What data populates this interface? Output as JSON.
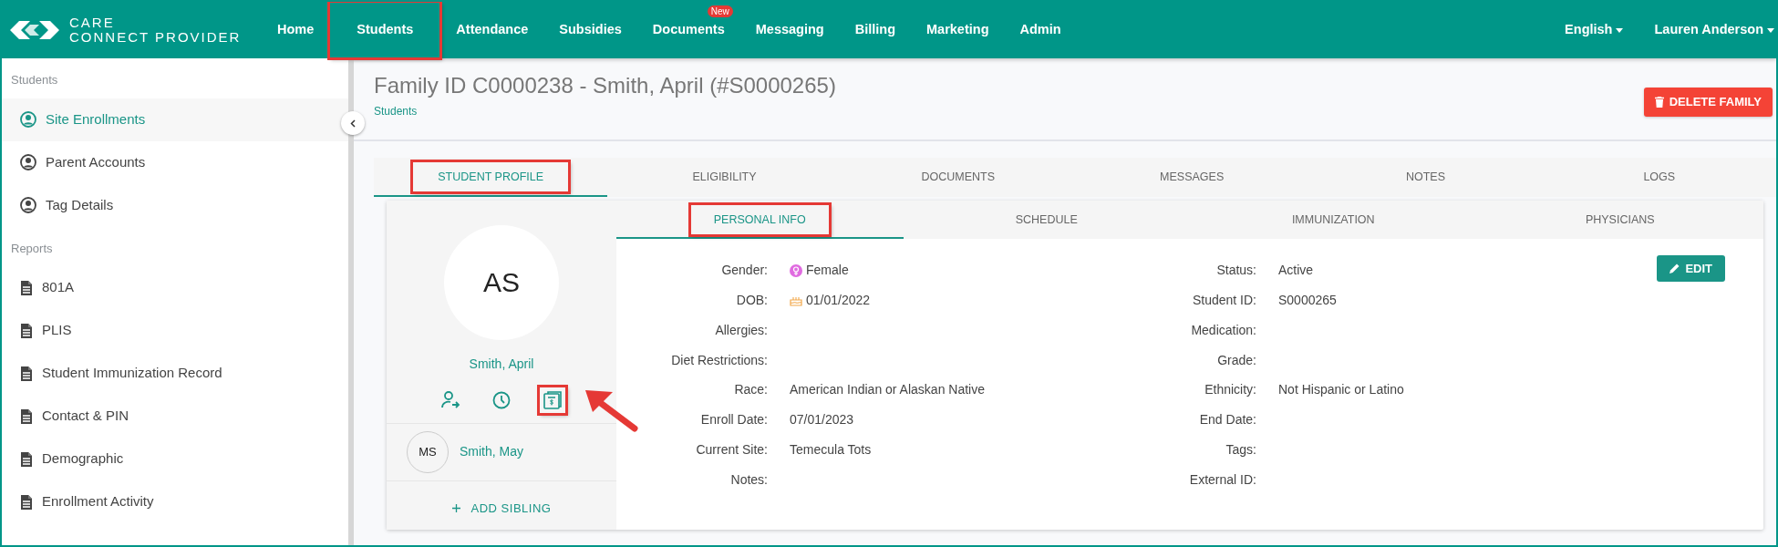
{
  "brand": {
    "line1": "CARE",
    "line2": "CONNECT PROVIDER"
  },
  "nav": {
    "items": [
      {
        "label": "Home",
        "highlighted": false
      },
      {
        "label": "Students",
        "highlighted": true
      },
      {
        "label": "Attendance",
        "highlighted": false
      },
      {
        "label": "Subsidies",
        "highlighted": false
      },
      {
        "label": "Documents",
        "highlighted": false,
        "badge": "New"
      },
      {
        "label": "Messaging",
        "highlighted": false
      },
      {
        "label": "Billing",
        "highlighted": false
      },
      {
        "label": "Marketing",
        "highlighted": false
      },
      {
        "label": "Admin",
        "highlighted": false
      }
    ],
    "language": "English",
    "user": "Lauren Anderson"
  },
  "sidebar": {
    "sections": [
      {
        "title": "Students",
        "items": [
          {
            "label": "Site Enrollments",
            "kind": "person",
            "selected": true
          },
          {
            "label": "Parent Accounts",
            "kind": "person",
            "selected": false
          },
          {
            "label": "Tag Details",
            "kind": "person",
            "selected": false
          }
        ]
      },
      {
        "title": "Reports",
        "items": [
          {
            "label": "801A",
            "kind": "document",
            "selected": false
          },
          {
            "label": "PLIS",
            "kind": "document",
            "selected": false
          },
          {
            "label": "Student Immunization Record",
            "kind": "document",
            "selected": false
          },
          {
            "label": "Contact & PIN",
            "kind": "document",
            "selected": false
          },
          {
            "label": "Demographic",
            "kind": "document",
            "selected": false
          },
          {
            "label": "Enrollment Activity",
            "kind": "document",
            "selected": false
          }
        ]
      }
    ]
  },
  "header": {
    "title": "Family ID C0000238 - Smith, April (#S0000265)",
    "breadcrumb": "Students",
    "delete_button": "DELETE FAMILY"
  },
  "tabs": [
    {
      "label": "STUDENT PROFILE",
      "selected": true,
      "highlighted": true
    },
    {
      "label": "ELIGIBILITY",
      "selected": false,
      "highlighted": false
    },
    {
      "label": "DOCUMENTS",
      "selected": false,
      "highlighted": false
    },
    {
      "label": "MESSAGES",
      "selected": false,
      "highlighted": false
    },
    {
      "label": "NOTES",
      "selected": false,
      "highlighted": false
    },
    {
      "label": "LOGS",
      "selected": false,
      "highlighted": false
    }
  ],
  "profile": {
    "initials": "AS",
    "name": "Smith, April",
    "actions": [
      {
        "kind": "transfer",
        "highlighted": false,
        "pointed": false
      },
      {
        "kind": "history",
        "highlighted": false,
        "pointed": false
      },
      {
        "kind": "billing",
        "highlighted": true,
        "pointed": true
      }
    ],
    "siblings": [
      {
        "initials": "MS",
        "name": "Smith, May"
      }
    ],
    "add_sibling": "ADD SIBLING"
  },
  "subtabs": [
    {
      "label": "PERSONAL INFO",
      "selected": true,
      "highlighted": true
    },
    {
      "label": "SCHEDULE",
      "selected": false,
      "highlighted": false
    },
    {
      "label": "IMMUNIZATION",
      "selected": false,
      "highlighted": false
    },
    {
      "label": "PHYSICIANS",
      "selected": false,
      "highlighted": false
    }
  ],
  "fields_left": [
    {
      "label": "Gender:",
      "value": "Female",
      "kind": "gender"
    },
    {
      "label": "DOB:",
      "value": "01/01/2022",
      "kind": "birthday"
    },
    {
      "label": "Allergies:"
    },
    {
      "label": "Diet Restrictions:"
    },
    {
      "label": "Race:",
      "value": "American Indian or Alaskan Native"
    },
    {
      "label": "Enroll Date:",
      "value": "07/01/2023"
    },
    {
      "label": "Current Site:",
      "value": "Temecula Tots"
    },
    {
      "label": "Notes:"
    }
  ],
  "fields_right": [
    {
      "label": "Status:",
      "value": "Active"
    },
    {
      "label": "Student ID:",
      "value": "S0000265"
    },
    {
      "label": "Medication:"
    },
    {
      "label": "Grade:"
    },
    {
      "label": "Ethnicity:",
      "value": "Not Hispanic or Latino"
    },
    {
      "label": "End Date:"
    },
    {
      "label": "Tags:"
    },
    {
      "label": "External ID:"
    }
  ],
  "edit_button": "EDIT"
}
